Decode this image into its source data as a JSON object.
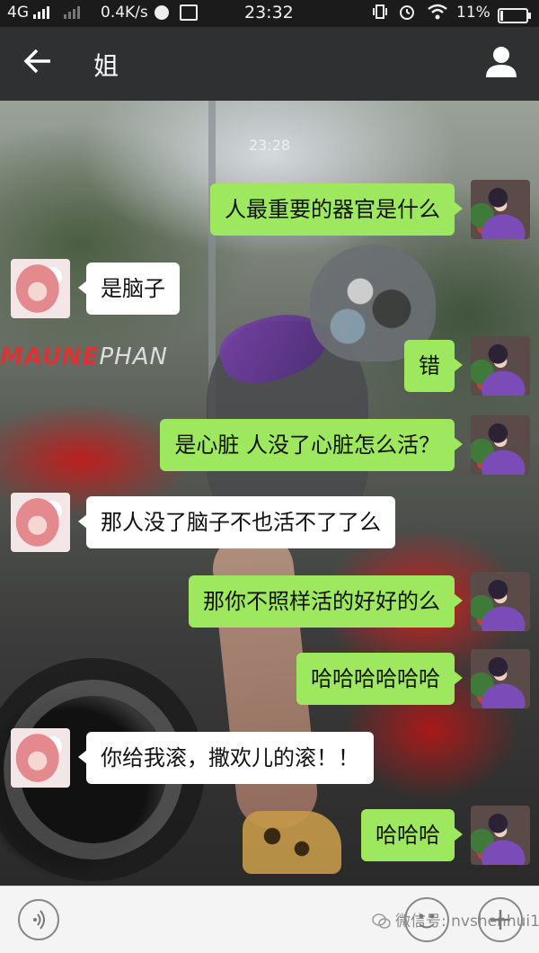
{
  "status_bar": {
    "network": "4G",
    "speed": "0.4K/s",
    "time": "23:32",
    "battery": "11%",
    "battery_level": 0.11
  },
  "header": {
    "title": "姐",
    "back_icon": "arrow-left-icon",
    "profile_icon": "person-icon"
  },
  "chat": {
    "timestamp": "23:28",
    "background_watermark": {
      "red": "MAUNE",
      "white": "PHAN"
    },
    "messages": [
      {
        "sender": "me",
        "text": "人最重要的器官是什么"
      },
      {
        "sender": "them",
        "text": "是脑子"
      },
      {
        "sender": "me",
        "text": "错"
      },
      {
        "sender": "me",
        "text": "是心脏 人没了心脏怎么活？"
      },
      {
        "sender": "them",
        "text": "那人没了脑子不也活不了了么"
      },
      {
        "sender": "me",
        "text": "那你不照样活的好好的么"
      },
      {
        "sender": "me",
        "text": "哈哈哈哈哈哈"
      },
      {
        "sender": "them",
        "text": "你给我滚，撒欢儿的滚！！"
      },
      {
        "sender": "me",
        "text": "哈哈哈"
      }
    ]
  },
  "input_bar": {
    "voice_icon": "voice-icon",
    "emoji_icon": "emoji-icon",
    "more_icon": "plus-icon",
    "watermark": "微信号: nvshenhui1"
  },
  "colors": {
    "my_bubble": "#9de85f",
    "their_bubble": "#ffffff",
    "header_bg": "#2f3032"
  }
}
